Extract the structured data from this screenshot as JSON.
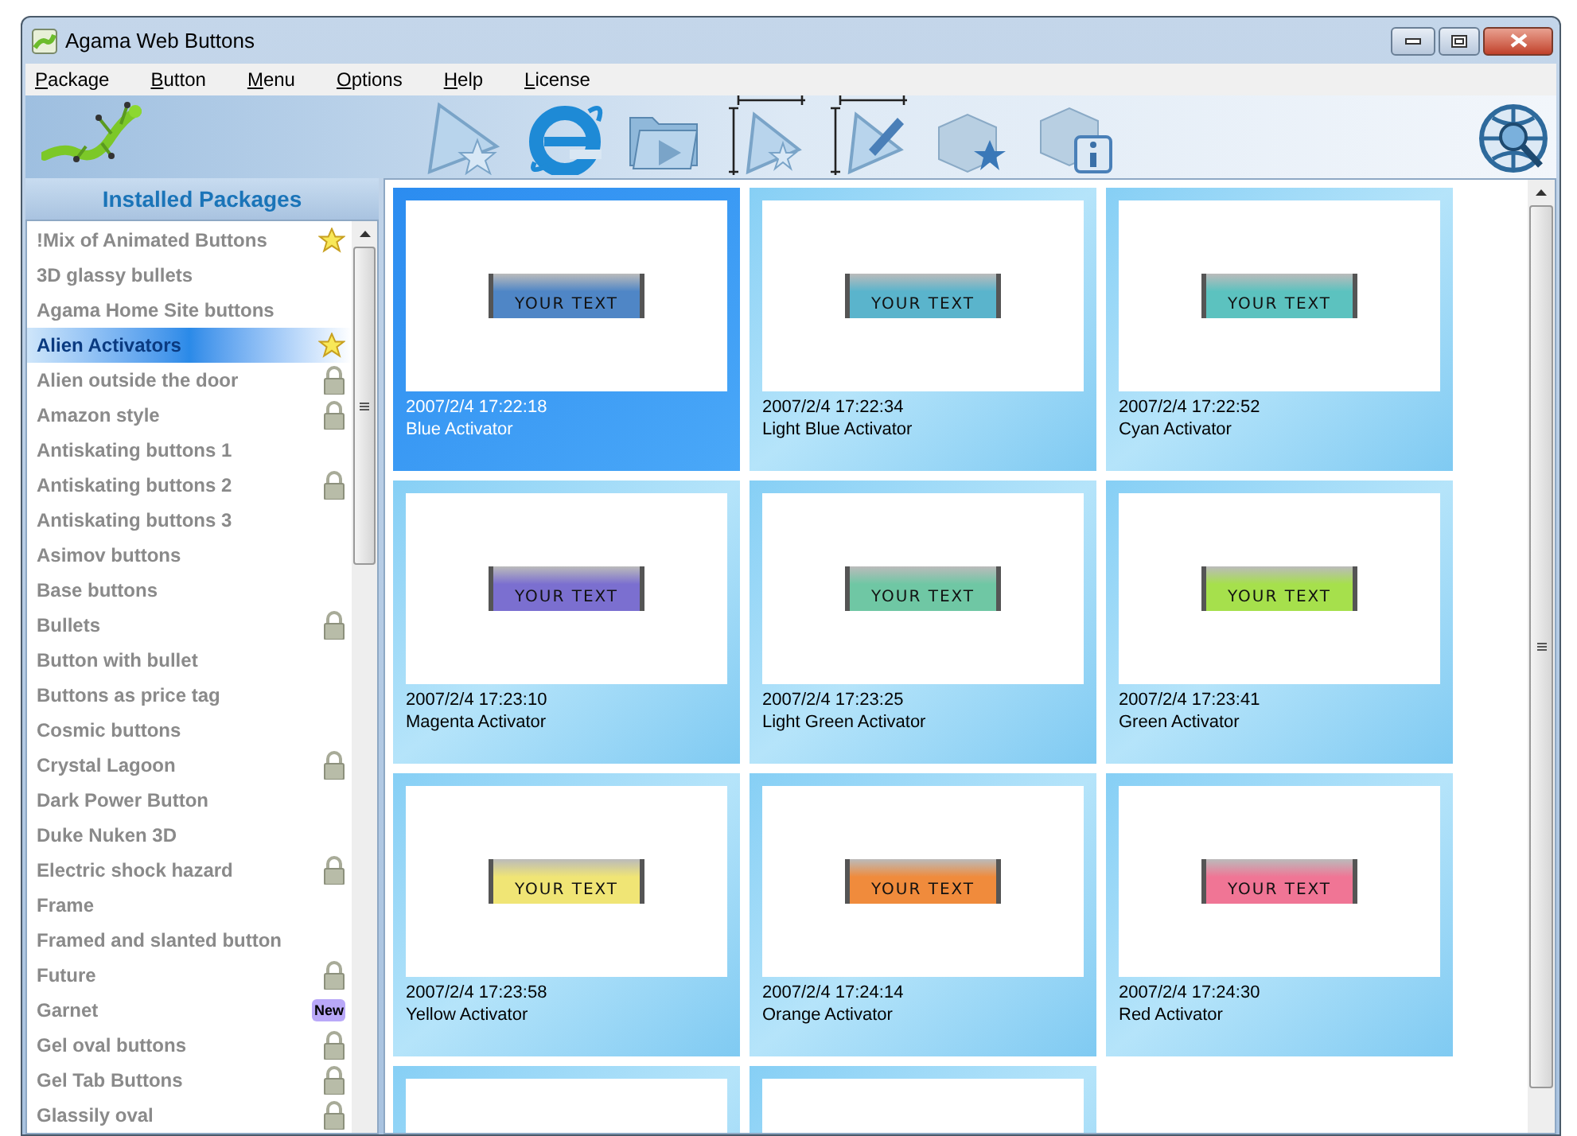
{
  "window": {
    "title": "Agama Web Buttons"
  },
  "menu": [
    {
      "label": "Package"
    },
    {
      "label": "Button"
    },
    {
      "label": "Menu"
    },
    {
      "label": "Options"
    },
    {
      "label": "Help"
    },
    {
      "label": "License"
    }
  ],
  "sidebar": {
    "title": "Installed Packages",
    "items": [
      {
        "label": "!Mix of Animated Buttons",
        "selected": false,
        "favorite": true,
        "locked": false
      },
      {
        "label": "3D glassy bullets",
        "selected": false,
        "favorite": false,
        "locked": false
      },
      {
        "label": "Agama Home Site buttons",
        "selected": false,
        "favorite": false,
        "locked": false
      },
      {
        "label": "Alien Activators",
        "selected": true,
        "favorite": true,
        "locked": false
      },
      {
        "label": "Alien outside the door",
        "selected": false,
        "favorite": false,
        "locked": true
      },
      {
        "label": "Amazon style",
        "selected": false,
        "favorite": false,
        "locked": true
      },
      {
        "label": "Antiskating buttons 1",
        "selected": false,
        "favorite": false,
        "locked": false
      },
      {
        "label": "Antiskating buttons 2",
        "selected": false,
        "favorite": false,
        "locked": true
      },
      {
        "label": "Antiskating buttons 3",
        "selected": false,
        "favorite": false,
        "locked": false
      },
      {
        "label": "Asimov buttons",
        "selected": false,
        "favorite": false,
        "locked": false
      },
      {
        "label": "Base buttons",
        "selected": false,
        "favorite": false,
        "locked": false
      },
      {
        "label": "Bullets",
        "selected": false,
        "favorite": false,
        "locked": true
      },
      {
        "label": "Button with bullet",
        "selected": false,
        "favorite": false,
        "locked": false
      },
      {
        "label": "Buttons as price tag",
        "selected": false,
        "favorite": false,
        "locked": false
      },
      {
        "label": "Cosmic buttons",
        "selected": false,
        "favorite": false,
        "locked": false
      },
      {
        "label": "Crystal Lagoon",
        "selected": false,
        "favorite": false,
        "locked": true
      },
      {
        "label": "Dark Power Button",
        "selected": false,
        "favorite": false,
        "locked": false
      },
      {
        "label": "Duke Nuken 3D",
        "selected": false,
        "favorite": false,
        "locked": false
      },
      {
        "label": "Electric shock hazard",
        "selected": false,
        "favorite": false,
        "locked": true
      },
      {
        "label": "Frame",
        "selected": false,
        "favorite": false,
        "locked": false
      },
      {
        "label": "Framed and slanted button",
        "selected": false,
        "favorite": false,
        "locked": false
      },
      {
        "label": "Future",
        "selected": false,
        "favorite": false,
        "locked": true
      },
      {
        "label": "Garnet",
        "selected": false,
        "favorite": false,
        "locked": false,
        "badge": "New"
      },
      {
        "label": "Gel oval buttons",
        "selected": false,
        "favorite": false,
        "locked": true
      },
      {
        "label": "Gel Tab Buttons",
        "selected": false,
        "favorite": false,
        "locked": true
      },
      {
        "label": "Glassily oval",
        "selected": false,
        "favorite": false,
        "locked": true
      }
    ]
  },
  "gallery": {
    "cards": [
      {
        "kind": "full",
        "date": "2007/2/4 17:22:18",
        "name": "Blue Activator",
        "preview_text": "YOUR TEXT",
        "color": "#4f86c6",
        "selected": true
      },
      {
        "kind": "full",
        "date": "2007/2/4 17:22:34",
        "name": "Light Blue Activator",
        "preview_text": "YOUR TEXT",
        "color": "#5ab4cc",
        "selected": false
      },
      {
        "kind": "full",
        "date": "2007/2/4 17:22:52",
        "name": "Cyan Activator",
        "preview_text": "YOUR TEXT",
        "color": "#5cc2bf",
        "selected": false
      },
      {
        "kind": "full",
        "date": "2007/2/4 17:23:10",
        "name": "Magenta Activator",
        "preview_text": "YOUR TEXT",
        "color": "#7b6fd0",
        "selected": false
      },
      {
        "kind": "full",
        "date": "2007/2/4 17:23:25",
        "name": "Light Green Activator",
        "preview_text": "YOUR TEXT",
        "color": "#6fc7a4",
        "selected": false
      },
      {
        "kind": "full",
        "date": "2007/2/4 17:23:41",
        "name": "Green Activator",
        "preview_text": "YOUR TEXT",
        "color": "#a6e04c",
        "selected": false
      },
      {
        "kind": "full",
        "date": "2007/2/4 17:23:58",
        "name": "Yellow Activator",
        "preview_text": "YOUR TEXT",
        "color": "#f0e575",
        "selected": false
      },
      {
        "kind": "full",
        "date": "2007/2/4 17:24:14",
        "name": "Orange Activator",
        "preview_text": "YOUR TEXT",
        "color": "#f08b3c",
        "selected": false
      },
      {
        "kind": "full",
        "date": "2007/2/4 17:24:30",
        "name": "Red Activator",
        "preview_text": "YOUR TEXT",
        "color": "#f07595",
        "selected": false
      },
      {
        "kind": "cut_off",
        "selected": false
      },
      {
        "kind": "cut_off",
        "selected": false
      }
    ]
  }
}
